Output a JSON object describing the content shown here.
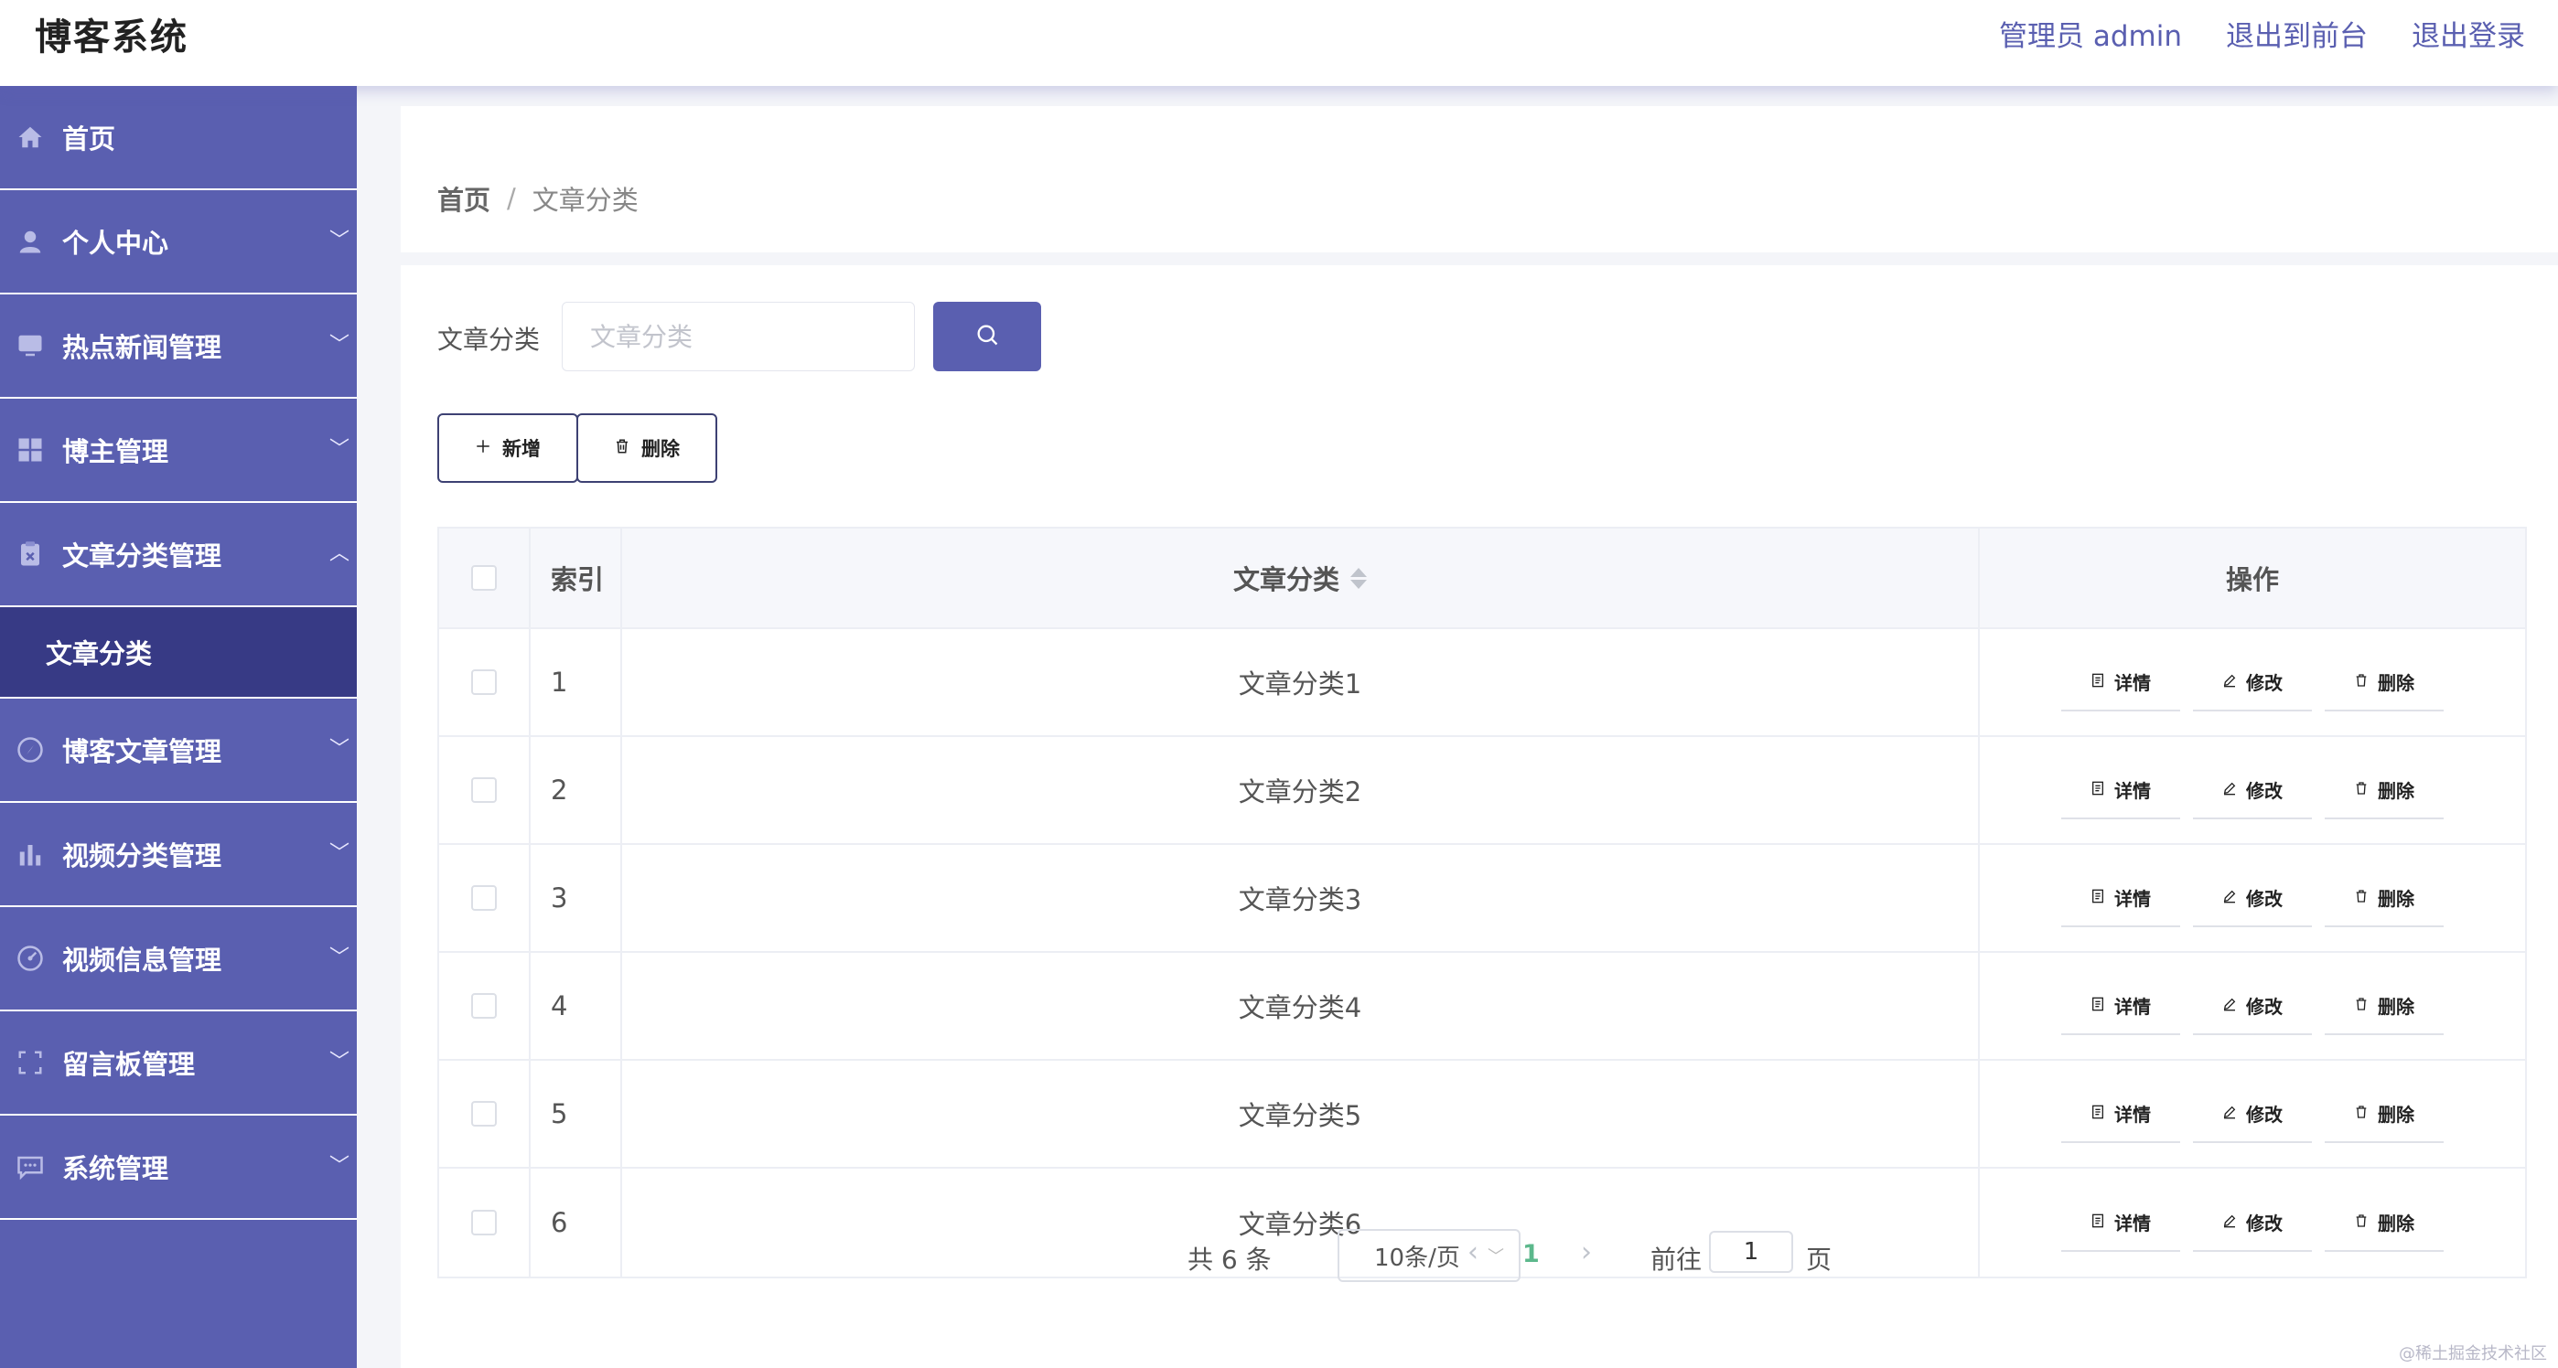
{
  "header": {
    "app_title": "博客系统",
    "admin_label": "管理员 admin",
    "to_frontend": "退出到前台",
    "logout": "退出登录"
  },
  "sidebar": {
    "items": [
      {
        "label": "首页",
        "icon": "home-icon",
        "has_chevron": false
      },
      {
        "label": "个人中心",
        "icon": "user-icon",
        "has_chevron": true
      },
      {
        "label": "热点新闻管理",
        "icon": "monitor-icon",
        "has_chevron": true
      },
      {
        "label": "博主管理",
        "icon": "grid-icon",
        "has_chevron": true
      },
      {
        "label": "文章分类管理",
        "icon": "clipboard-icon",
        "has_chevron": true,
        "expanded": true
      },
      {
        "label": "博客文章管理",
        "icon": "compass-icon",
        "has_chevron": true
      },
      {
        "label": "视频分类管理",
        "icon": "bar-chart-icon",
        "has_chevron": true
      },
      {
        "label": "视频信息管理",
        "icon": "gauge-icon",
        "has_chevron": true
      },
      {
        "label": "留言板管理",
        "icon": "fullscreen-icon",
        "has_chevron": true
      },
      {
        "label": "系统管理",
        "icon": "chat-icon",
        "has_chevron": true
      }
    ],
    "active_sub_item": "文章分类",
    "colors": {
      "background": "#5a5fb0",
      "active_background": "#373a85"
    }
  },
  "breadcrumb": {
    "home": "首页",
    "separator": "/",
    "current": "文章分类"
  },
  "search": {
    "label": "文章分类",
    "placeholder": "文章分类",
    "value": ""
  },
  "toolbar": {
    "add_label": "新增",
    "delete_label": "删除"
  },
  "table": {
    "columns": {
      "index": "索引",
      "name": "文章分类",
      "ops": "操作"
    },
    "rows": [
      {
        "index": "1",
        "name": "文章分类1"
      },
      {
        "index": "2",
        "name": "文章分类2"
      },
      {
        "index": "3",
        "name": "文章分类3"
      },
      {
        "index": "4",
        "name": "文章分类4"
      },
      {
        "index": "5",
        "name": "文章分类5"
      },
      {
        "index": "6",
        "name": "文章分类6"
      }
    ],
    "row_actions": {
      "detail": "详情",
      "edit": "修改",
      "delete": "删除"
    }
  },
  "pagination": {
    "total": "共 6 条",
    "page_size": "10条/页",
    "current_page": "1",
    "goto_label": "前往",
    "goto_value": "1",
    "page_unit": "页"
  },
  "watermark": "@稀土掘金技术社区",
  "colors": {
    "accent": "#5a5fb0",
    "active_page": "#5cb88c"
  }
}
